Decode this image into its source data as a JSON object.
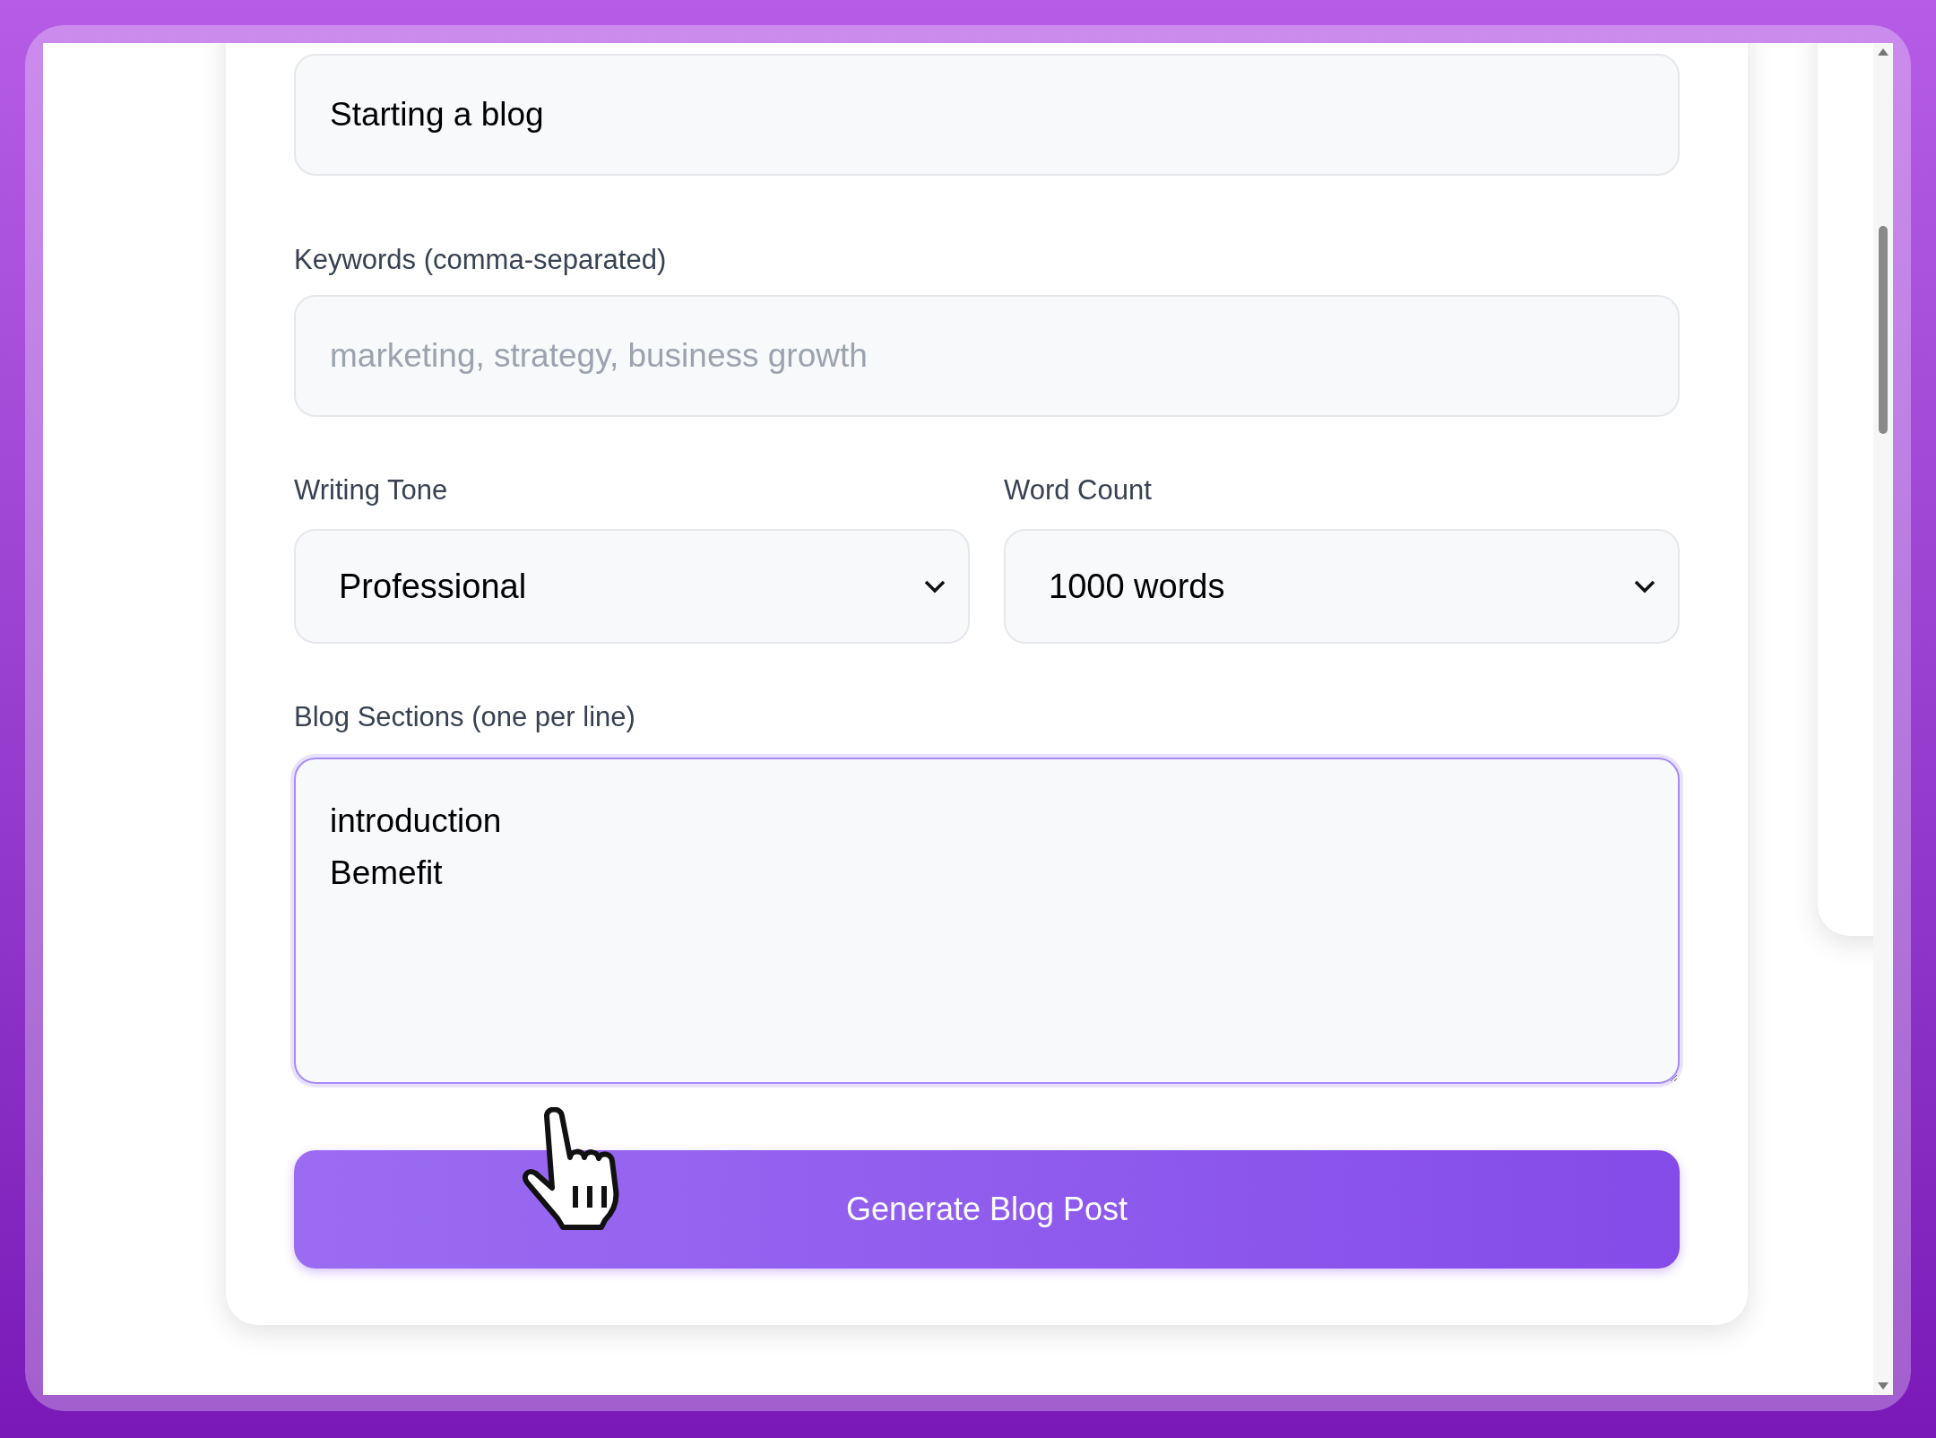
{
  "form": {
    "topic": {
      "value": "Starting a blog"
    },
    "keywords": {
      "label": "Keywords (comma-separated)",
      "placeholder": "marketing, strategy, business growth"
    },
    "tone": {
      "label": "Writing Tone",
      "value": "Professional"
    },
    "word_count": {
      "label": "Word Count",
      "value": "1000 words"
    },
    "sections": {
      "label": "Blog Sections (one per line)",
      "value": "introduction\nBemefit",
      "focused": true
    },
    "submit": {
      "label": "Generate Blog Post"
    }
  }
}
